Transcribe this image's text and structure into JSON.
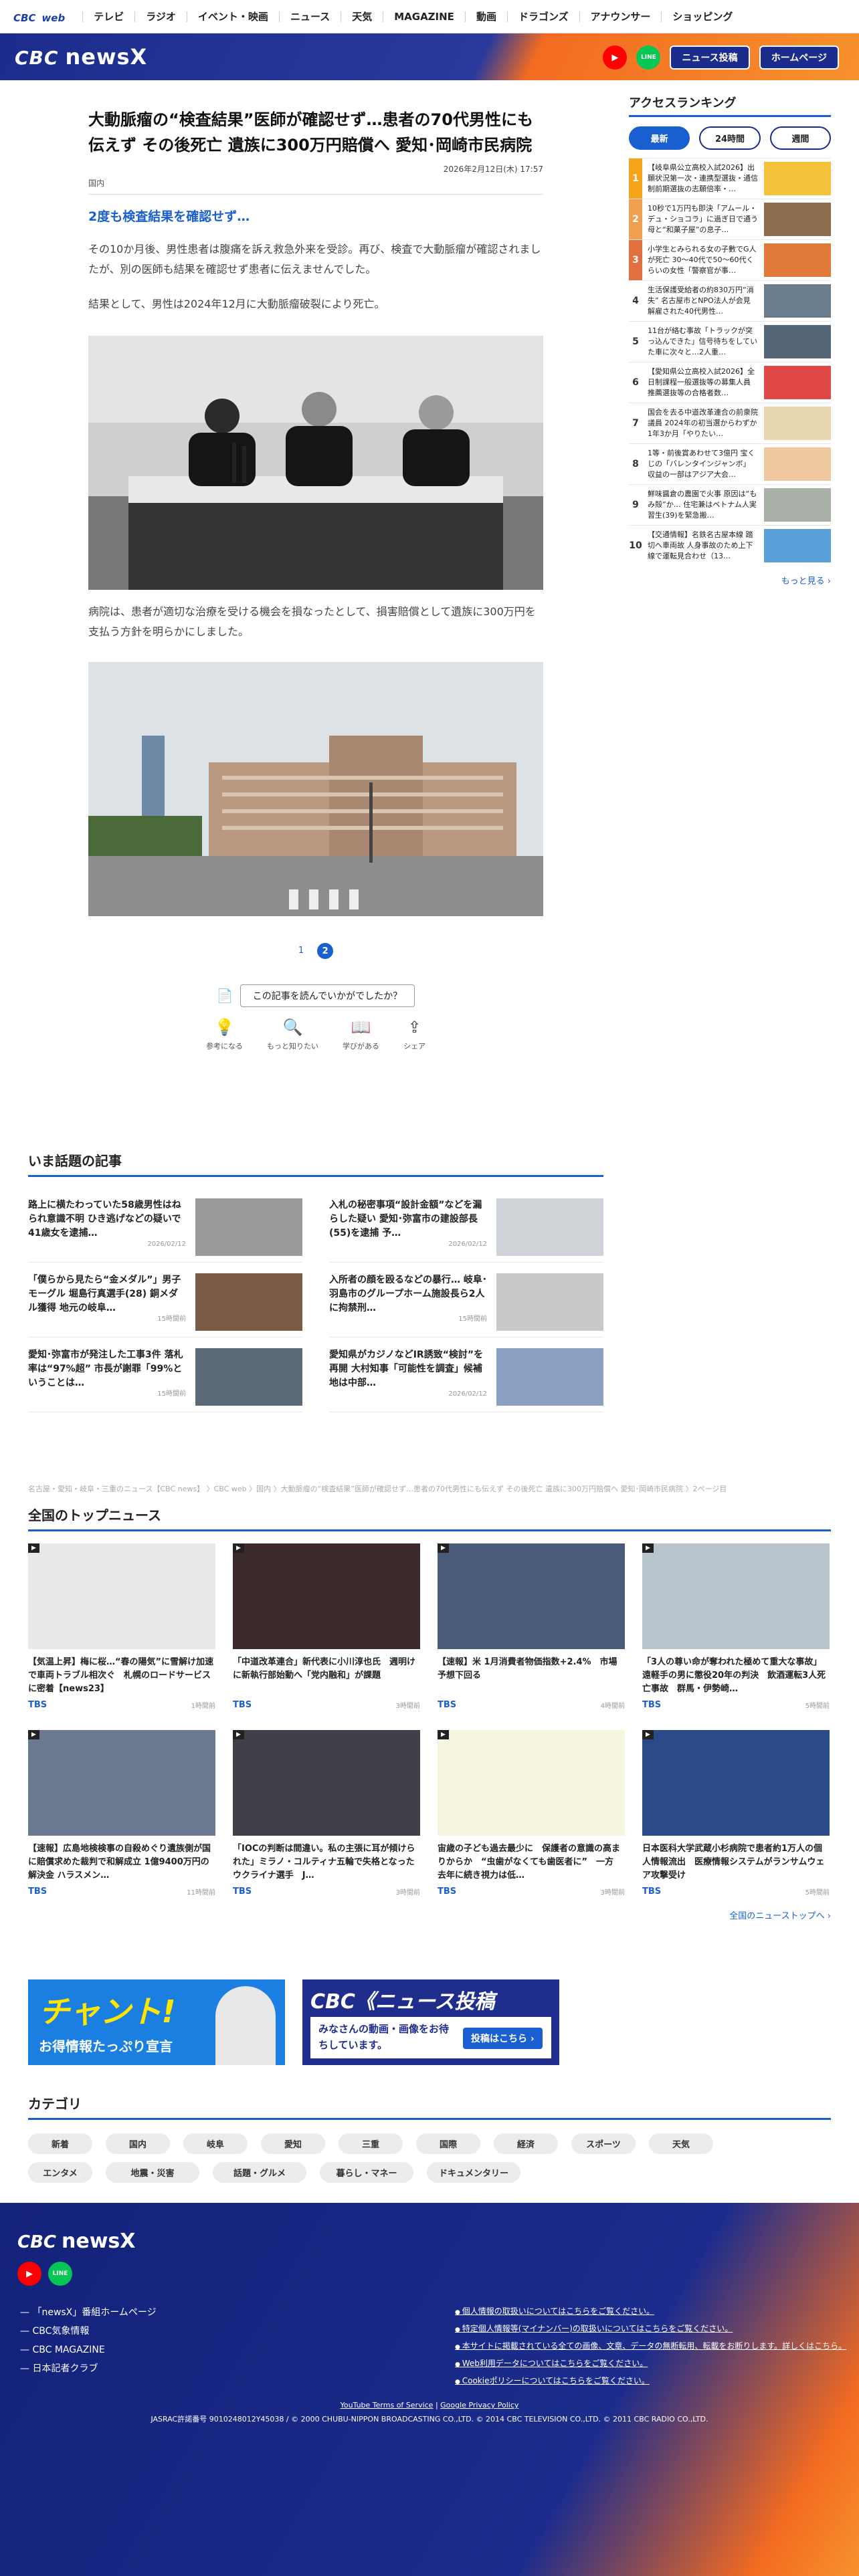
{
  "nav": {
    "logo": "CBC",
    "logo_sub": "web",
    "items": [
      "テレビ",
      "ラジオ",
      "イベント・映画",
      "ニュース",
      "天気",
      "MAGAZINE",
      "動画",
      "ドラゴンズ",
      "アナウンサー",
      "ショッピング"
    ]
  },
  "header": {
    "logo": "CBC",
    "logo_main": "newsX",
    "youtube": "▶",
    "line": "LINE",
    "post": "ニュース投稿",
    "home": "ホームページ"
  },
  "article": {
    "title": "大動脈瘤の“検査結果”医師が確認せず…患者の70代男性にも伝えず その後死亡 遺族に300万円賠償へ 愛知･岡崎市民病院",
    "date": "2026年2月12日(木) 17:57",
    "category": "国内",
    "subhead": "2度も検査結果を確認せず…",
    "p1": "その10か月後、男性患者は腹痛を訴え救急外来を受診。再び、検査で大動脈瘤が確認されましたが、別の医師も結果を確認せず患者に伝えませんでした。",
    "p2": "結果として、男性は2024年12月に大動脈瘤破裂により死亡。",
    "p3": "病院は、患者が適切な治療を受ける機会を損なったとして、損害賠償として遺族に300万円を支払う方針を明らかにしました。",
    "pages": [
      "1",
      "2"
    ],
    "feedback_q": "この記事を読んでいかがでしたか？",
    "feedback": [
      "参考になる",
      "もっと知りたい",
      "学びがある",
      "シェア"
    ]
  },
  "ranking": {
    "title": "アクセスランキング",
    "tabs": [
      "最新",
      "24時間",
      "週間"
    ],
    "items": [
      {
        "n": "1",
        "t": "【岐阜県公立高校入試2026】出願状況第一次・連携型選抜・通信制前期選抜の志願倍率・…"
      },
      {
        "n": "2",
        "t": "10秒で1万円も即決「アムール・デュ・ショコラ」に過ぎ日で通う母と“和菓子屋”の息子…"
      },
      {
        "n": "3",
        "t": "小学生とみられる女の子數でG人が死亡 30～40代で50～60代くらいの女性「警察官が事…"
      },
      {
        "n": "4",
        "t": "生活保護受給者の約830万円“消失” 名古屋市とNPO法人が会見 解雇された40代男性…"
      },
      {
        "n": "5",
        "t": "11台が絡む事故「トラックが突っ込んできた」信号待ちをしていた車に次々と…2人重…"
      },
      {
        "n": "6",
        "t": "【愛知県公立高校入試2026】全日制課程一般選抜等の募集人員 推薦選抜等の合格者数…"
      },
      {
        "n": "7",
        "t": "国会を去る中道改革連合の前衆院議員 2024年の初当選からわずか1年3か月「やりたい…"
      },
      {
        "n": "8",
        "t": "1等・前後賞あわせて3億円 宝くじの「バレンタインジャンボ」 収益の一部はアジア大会…"
      },
      {
        "n": "9",
        "t": "鮮味醤倉の農園で火事 原因は“もみ殻”か… 住宅兼はベトナム人実習生(39)を緊急搬…"
      },
      {
        "n": "10",
        "t": "【交通情報】名鉄名古屋本線 踏切へ車両故 人身事故のため上下線で運転見合わせ（13…"
      }
    ],
    "more": "もっと見る"
  },
  "hot": {
    "title": "いま話題の記事",
    "items": [
      {
        "t": "路上に横たわっていた58歳男性はねられ意識不明 ひき逃げなどの疑いで41歳女を逮捕…",
        "ago": "2026/02/12"
      },
      {
        "t": "入札の秘密事項“設計金額”などを漏らした疑い 愛知･弥富市の建設部長(55)を逮捕 予…",
        "ago": "2026/02/12"
      },
      {
        "t": "「僕らから見たら“金メダル”」男子モーグル 堀島行真選手(28) 銅メダル獲得 地元の岐阜…",
        "ago": "15時間前"
      },
      {
        "t": "入所者の顔を殴るなどの暴行… 岐阜･羽島市のグループホーム施設長ら2人に拘禁刑…",
        "ago": "15時間前"
      },
      {
        "t": "愛知･弥富市が発注した工事3件 落札率は“97%超” 市長が謝罪「99%ということは…",
        "ago": "15時間前"
      },
      {
        "t": "愛知県がカジノなどIR誘致“検討”を再開 大村知事「可能性を調査」候補地は中部…",
        "ago": "2026/02/12"
      }
    ]
  },
  "breadcrumb": "名古屋・愛知・岐阜・三重のニュース【CBC news】 〉CBC web 〉国内 〉大動脈瘤の“検査結果”医師が確認せず…患者の70代男性にも伝えず その後死亡 遺族に300万円賠償へ 愛知･岡崎市民病院 〉2ページ目",
  "national": {
    "title": "全国のトップニュース",
    "items": [
      {
        "t": "【気温上昇】梅に桜…“春の陽気”に雪解け加速で車両トラブル相次ぐ　札幌のロードサービスに密着【news23】",
        "src": "TBS",
        "ago": "1時間前"
      },
      {
        "t": "「中道改革連合」新代表に小川淳也氏　週明けに新執行部始動へ「党内融和」が課題",
        "src": "TBS",
        "ago": "3時間前"
      },
      {
        "t": "【速報】米 1月消費者物価指数+2.4%　市場予想下回る",
        "src": "TBS",
        "ago": "4時間前"
      },
      {
        "t": "「3人の尊い命が奪われた極めて重大な事故」遠軽手の男に懲役20年の判決　飲酒運転3人死亡事故　群馬・伊勢崎…",
        "src": "TBS",
        "ago": "5時間前"
      },
      {
        "t": "【速報】広島地検検事の自殺めぐり遺族側が国に賠償求めた裁判で和解成立 1億9400万円の解決金 ハラスメン…",
        "src": "TBS",
        "ago": "11時間前"
      },
      {
        "t": "「IOCの判断は間違い。私の主張に耳が傾けられた」ミラノ・コルティナ五輪で失格となったウクライナ選手　J…",
        "src": "TBS",
        "ago": "3時間前"
      },
      {
        "t": "宙歳の子ども過去最少に　保護者の意識の高まりからか　“虫歯がなくても歯医者に”　一方　去年に続き視力は低…",
        "src": "TBS",
        "ago": "3時間前"
      },
      {
        "t": "日本医科大学武蔵小杉病院で患者約1万人の個人情報流出　医療情報システムがランサムウェア攻撃受け",
        "src": "TBS",
        "ago": "5時間前"
      }
    ],
    "more": "全国のニューストップへ"
  },
  "banners": {
    "b1_title": "チャント!",
    "b1_sub": "お得情報たっぷり宣言",
    "b2_title": "CBC《ニュース投稿",
    "b2_sub": "みなさんの動画・画像をお待ちしています。",
    "b2_btn": "投稿はこちら ›"
  },
  "categories": {
    "title": "カテゴリ",
    "items": [
      "新着",
      "国内",
      "岐阜",
      "愛知",
      "三重",
      "国際",
      "経済",
      "スポーツ",
      "天気",
      "エンタメ",
      "地震・災害",
      "話題・グルメ",
      "暮らし・マネー",
      "ドキュメンタリー"
    ]
  },
  "footer": {
    "logo": "CBC",
    "logo_main": "newsX",
    "links": [
      "「newsX」番組ホームページ",
      "CBC気象情報",
      "CBC MAGAZINE",
      "日本記者クラブ"
    ],
    "right": [
      "個人情報の取扱いについてはこちらをご覧ください。",
      "特定個人情報等(マイナンバー)の取扱いについてはこちらをご覧ください。",
      "本サイトに掲載されている全ての画像、文章、データの無断転用、転載をお断りします。詳しくはこちら。",
      "Web利用データについてはこちらをご覧ください。",
      "Cookieポリシーについてはこちらをご覧ください。"
    ],
    "yt_terms": "YouTube Terms of Service",
    "google_privacy": "Google Privacy Policy",
    "copyright": "JASRAC許諾番号 9010248012Y45038 / © 2000 CHUBU-NIPPON BROADCASTING CO.,LTD. © 2014 CBC TELEVISION CO.,LTD. © 2011 CBC RADIO CO.,LTD."
  },
  "colors": {
    "accent": "#1a5fd0",
    "navy": "#1c2c8c",
    "orange": "#f36b21"
  }
}
